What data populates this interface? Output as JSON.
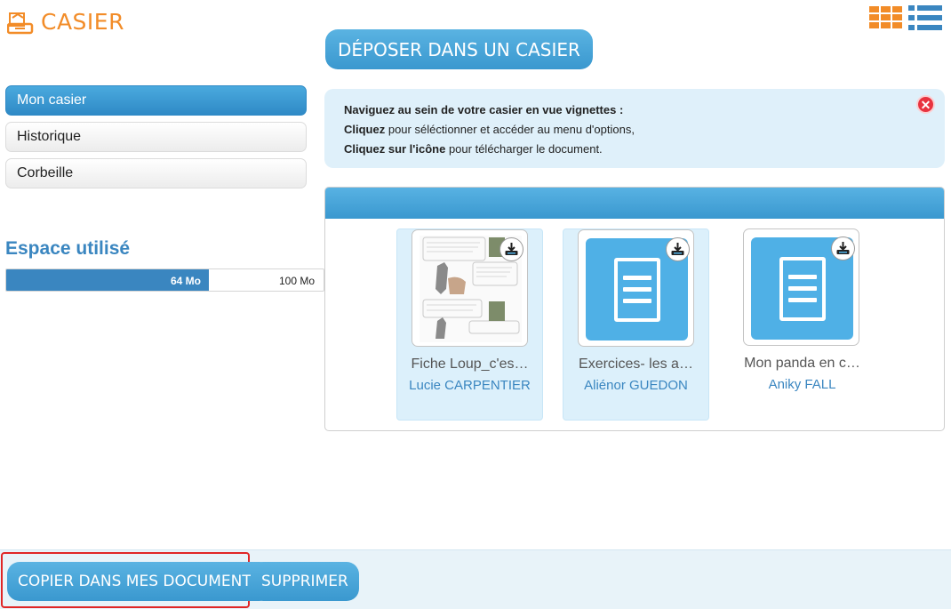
{
  "app": {
    "title": "CASIER"
  },
  "toolbar": {
    "deposit_label": "DÉPOSER DANS UN CASIER"
  },
  "sidebar": {
    "items": [
      {
        "label": "Mon casier",
        "active": true
      },
      {
        "label": "Historique",
        "active": false
      },
      {
        "label": "Corbeille",
        "active": false
      }
    ]
  },
  "storage": {
    "title": "Espace utilisé",
    "used_label": "64 Mo",
    "total_label": "100 Mo",
    "used_fraction": 0.64
  },
  "info": {
    "line1": "Naviguez au sein de votre casier en vue vignettes :",
    "line2_bold": "Cliquez",
    "line2_rest": " pour séléctionner et accéder au menu d'options,",
    "line3_bold": "Cliquez sur l'icône",
    "line3_rest": " pour télécharger le document."
  },
  "files": [
    {
      "name": "Fiche Loup_c'es…",
      "author": "Lucie CARPENTIER",
      "selected": true,
      "thumb": "comic-page"
    },
    {
      "name": "Exercices- les a…",
      "author": "Aliénor GUEDON",
      "selected": true,
      "thumb": "document-icon"
    },
    {
      "name": "Mon panda en c…",
      "author": "Aniky FALL",
      "selected": false,
      "thumb": "document-icon"
    }
  ],
  "actions": {
    "copy_label": "COPIER DANS MES DOCUMENTS",
    "delete_label": "SUPPRIMER"
  },
  "colors": {
    "accent_blue": "#3a98cf",
    "title_orange": "#f28c28",
    "close_red": "#e8333f",
    "highlight_red": "#e02626"
  }
}
